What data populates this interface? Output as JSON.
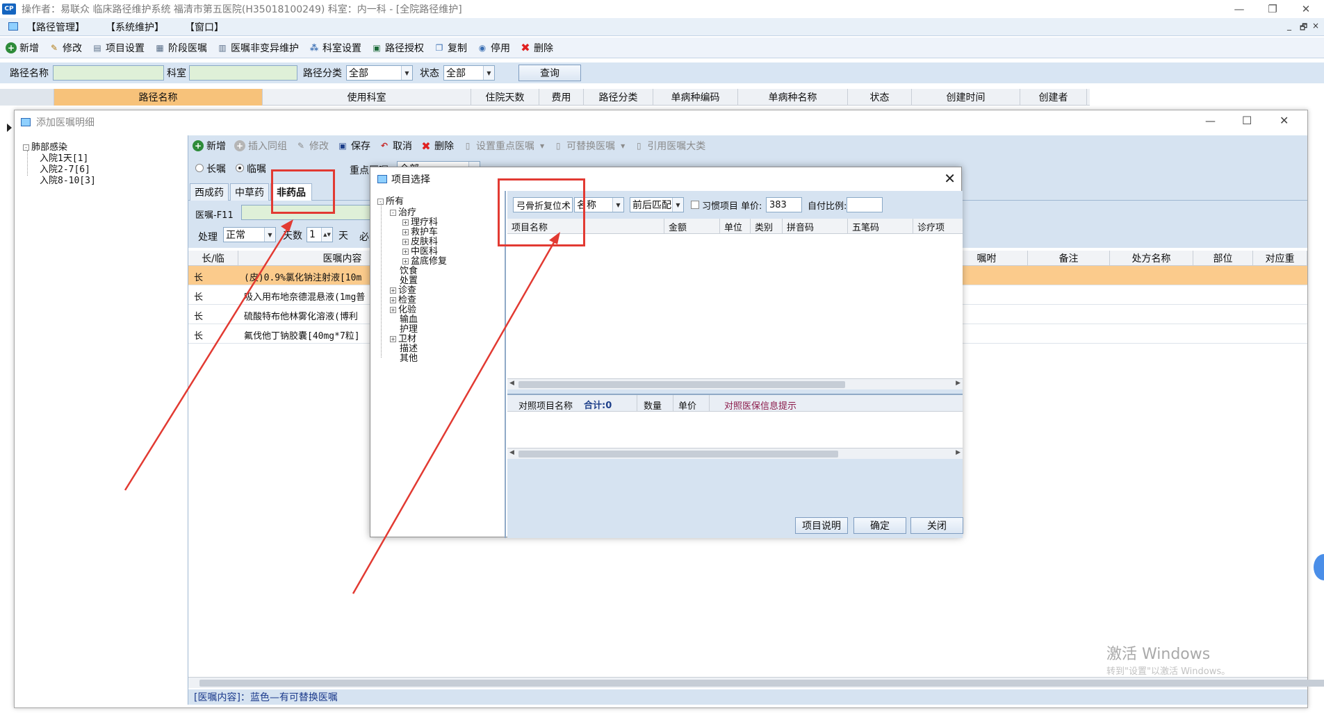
{
  "titlebar": {
    "text": "操作者：易联众 临床路径维护系统  福清市第五医院(H35018100249)  科室：内一科 - [全院路径维护]",
    "logo": "CP",
    "controls": [
      "—",
      "❐",
      "✕"
    ]
  },
  "menubar": {
    "items": [
      "【路径管理】",
      "【系统维护】",
      "【窗口】"
    ],
    "mdi_controls": [
      "_",
      "🗗",
      "×"
    ]
  },
  "toolbar": {
    "items": [
      {
        "label": "新增",
        "icon": "add-icon"
      },
      {
        "label": "修改",
        "icon": "edit-icon"
      },
      {
        "label": "项目设置",
        "icon": "settings-icon"
      },
      {
        "label": "阶段医嘱",
        "icon": "stage-icon"
      },
      {
        "label": "医嘱非变异维护",
        "icon": "doc-icon"
      },
      {
        "label": "科室设置",
        "icon": "dept-icon"
      },
      {
        "label": "路径授权",
        "icon": "auth-icon"
      },
      {
        "label": "复制",
        "icon": "copy-icon"
      },
      {
        "label": "停用",
        "icon": "stop-icon"
      },
      {
        "label": "删除",
        "icon": "delete-icon"
      }
    ]
  },
  "filter": {
    "name_label": "路径名称",
    "dept_label": "科室",
    "category_label": "路径分类",
    "category_value": "全部",
    "status_label": "状态",
    "status_value": "全部",
    "query_button": "查询"
  },
  "main_grid": {
    "columns": [
      "路径名称",
      "使用科室",
      "住院天数",
      "费用",
      "路径分类",
      "单病种编码",
      "单病种名称",
      "状态",
      "创建时间",
      "创建者"
    ]
  },
  "win_add": {
    "title": "添加医嘱明细",
    "controls": [
      "—",
      "☐",
      "✕"
    ],
    "tree": {
      "root": "肺部感染",
      "children": [
        "入院1天[1]",
        "入院2-7[6]",
        "入院8-10[3]"
      ]
    },
    "toolbar": {
      "items": [
        {
          "label": "新增",
          "enabled": true
        },
        {
          "label": "插入同组",
          "enabled": false
        },
        {
          "label": "修改",
          "enabled": false
        },
        {
          "label": "保存",
          "enabled": true
        },
        {
          "label": "取消",
          "enabled": true
        },
        {
          "label": "删除",
          "enabled": true
        },
        {
          "label": "设置重点医嘱",
          "enabled": false
        },
        {
          "label": "可替换医嘱",
          "enabled": false
        },
        {
          "label": "引用医嘱大类",
          "enabled": false
        }
      ]
    },
    "options": {
      "long_label": "长嘱",
      "temp_label": "临嘱",
      "key_label": "重点医嘱",
      "key_value": "全部"
    },
    "tabs": [
      "西成药",
      "中草药",
      "非药品"
    ],
    "form": {
      "order_label": "医嘱-F11",
      "handle_label": "处理",
      "handle_value": "正常",
      "days_label": "天数",
      "days_value": "1",
      "days_unit": "天",
      "required_label": "必选"
    },
    "orders": {
      "columns": [
        "长/临",
        "医嘱内容",
        "嘱咐",
        "备注",
        "处方名称",
        "部位",
        "对应重"
      ],
      "rows": [
        {
          "type": "长",
          "content": "(皮)0.9%氯化钠注射液[10m"
        },
        {
          "type": "长",
          "content": "吸入用布地奈德混悬液(1mg普"
        },
        {
          "type": "长",
          "content": "硫酸特布他林雾化溶液(博利"
        },
        {
          "type": "长",
          "content": "氟伐他丁钠胶囊[40mg*7粒]"
        }
      ]
    },
    "status_text": "[医嘱内容]：蓝色—有可替换医嘱"
  },
  "dialog": {
    "title": "项目选择",
    "tree": {
      "root": "所有",
      "nodes": [
        {
          "label": "治疗",
          "level": 1,
          "expander": "-"
        },
        {
          "label": "理疗科",
          "level": 2,
          "expander": "+"
        },
        {
          "label": "救护车",
          "level": 2,
          "expander": "+"
        },
        {
          "label": "皮肤科",
          "level": 2,
          "expander": "+"
        },
        {
          "label": "中医科",
          "level": 2,
          "expander": "+"
        },
        {
          "label": "盆底修复",
          "level": 2,
          "expander": "+"
        },
        {
          "label": "饮食",
          "level": 1,
          "expander": ""
        },
        {
          "label": "处置",
          "level": 1,
          "expander": ""
        },
        {
          "label": "诊查",
          "level": 1,
          "expander": "+"
        },
        {
          "label": "检查",
          "level": 1,
          "expander": "+"
        },
        {
          "label": "化验",
          "level": 1,
          "expander": "+"
        },
        {
          "label": "输血",
          "level": 1,
          "expander": ""
        },
        {
          "label": "护理",
          "level": 1,
          "expander": ""
        },
        {
          "label": "卫材",
          "level": 1,
          "expander": "+"
        },
        {
          "label": "描述",
          "level": 1,
          "expander": ""
        },
        {
          "label": "其他",
          "level": 1,
          "expander": ""
        }
      ]
    },
    "search": {
      "value": "弓骨折复位术",
      "field_value": "名称",
      "match_value": "前后匹配",
      "habit_label": "习惯项目",
      "price_label": "单价:",
      "price_value": "383",
      "ratio_label": "自付比例:"
    },
    "grid_columns": [
      "项目名称",
      "金额",
      "单位",
      "类别",
      "拼音码",
      "五笔码",
      "诊疗项"
    ],
    "bottom": {
      "name_label": "对照项目名称",
      "total_label": "合计:0",
      "qty_label": "数量",
      "price_label": "单价",
      "hint_label": "对照医保信息提示"
    },
    "buttons": [
      "项目说明",
      "确定",
      "关闭"
    ]
  },
  "watermark": {
    "line1": "激活 Windows",
    "line2": "转到\"设置\"以激活 Windows。"
  },
  "colors": {
    "highlight_row": "#fbcb8c",
    "annotation_red": "#e23a32",
    "panel_blue": "#d6e3f1"
  }
}
